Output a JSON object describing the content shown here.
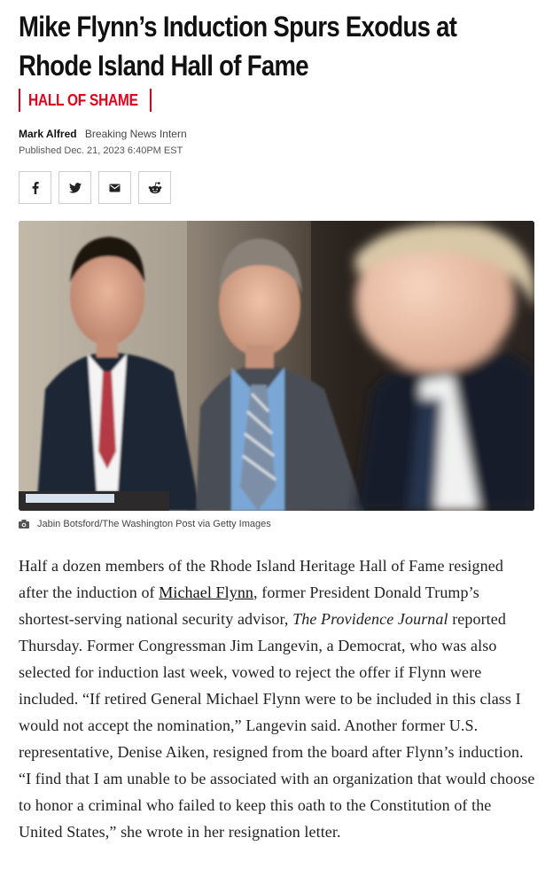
{
  "article": {
    "headline": "Mike Flynn’s Induction Spurs Exodus at Rhode Island Hall of Fame",
    "kicker": "HALL OF SHAME",
    "author": "Mark Alfred",
    "author_role": "Breaking News Intern",
    "published": "Published Dec. 21, 2023 6:40PM EST"
  },
  "share": {
    "icons": [
      "facebook-icon",
      "twitter-icon",
      "email-icon",
      "reddit-icon"
    ]
  },
  "photo": {
    "caption": "Jabin Botsford/The Washington Post via Getty Images"
  },
  "body": {
    "p1_a": "Half a dozen members of the Rhode Island Heritage Hall of Fame resigned after the induction of ",
    "p1_link": "Michael Flynn",
    "p1_b": ", former President Donald Trump’s shortest-serving national security advisor, ",
    "p1_pub": "The Providence Journal",
    "p1_c": " reported Thursday. Former Congressman Jim Langevin, a Democrat, who was also selected for induction last week, vowed to reject the offer if Flynn were included. “If retired General Michael Flynn were to be included in this class I would not accept the nomination,” Langevin said. Another former U.S. representative, Denise Aiken, resigned from the board after Flynn’s induction. “I find that I am unable to be associated with an organization that would choose to honor a criminal who failed to keep this oath to the Constitution of the United States,” she wrote in her resignation letter."
  },
  "colors": {
    "accent": "#e0001b",
    "text": "#222222"
  }
}
